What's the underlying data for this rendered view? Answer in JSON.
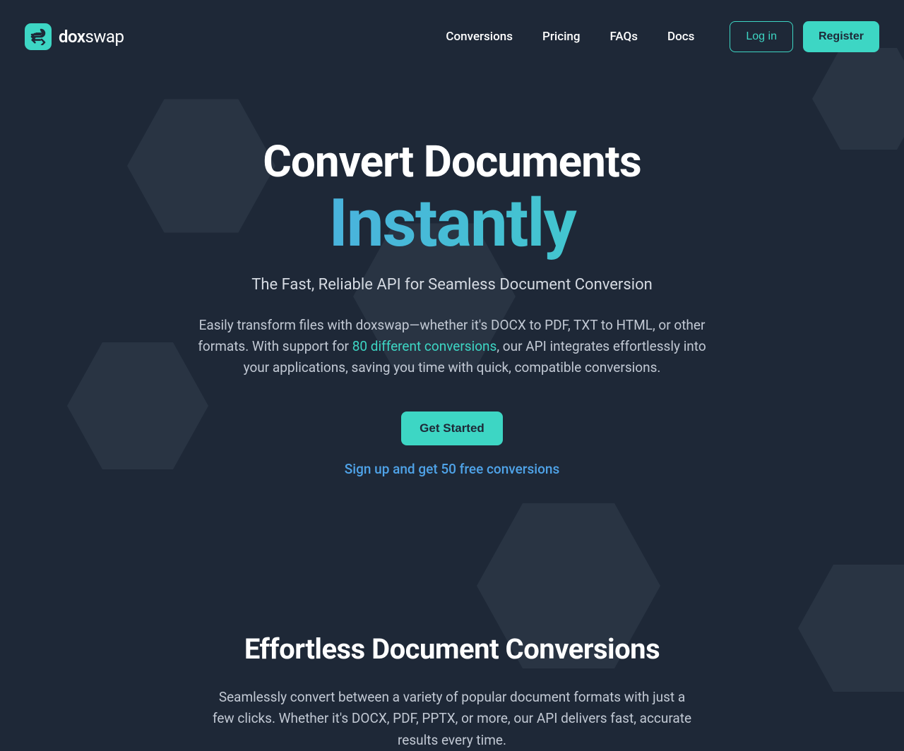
{
  "brand": {
    "name_bold": "dox",
    "name_light": "swap"
  },
  "nav": {
    "links": [
      "Conversions",
      "Pricing",
      "FAQs",
      "Docs"
    ],
    "login": "Log in",
    "register": "Register"
  },
  "hero": {
    "title_line1": "Convert Documents",
    "title_highlight": "Instantly",
    "subtitle": "The Fast, Reliable API for Seamless Document Conversion",
    "desc_before": "Easily transform files with doxswap—whether it's DOCX to PDF, TXT to HTML, or other formats. With support for ",
    "desc_link": "80 different conversions",
    "desc_after": ", our API integrates effortlessly into your applications, saving you time with quick, compatible conversions.",
    "cta": "Get Started",
    "note": "Sign up and get 50 free conversions"
  },
  "section2": {
    "title": "Effortless Document Conversions",
    "desc": "Seamlessly convert between a variety of popular document formats with just a few clicks. Whether it's DOCX, PDF, PPTX, or more, our API delivers fast, accurate results every time."
  }
}
